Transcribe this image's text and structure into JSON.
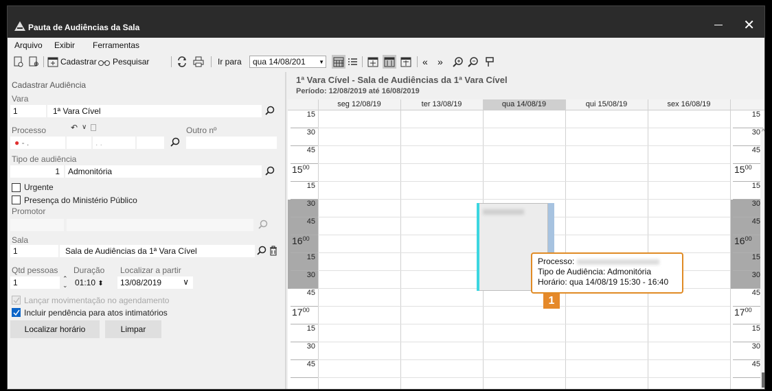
{
  "window": {
    "title": "Pauta de Audiências da Sala"
  },
  "menu": [
    "Arquivo",
    "Exibir",
    "Ferramentas"
  ],
  "toolbar": {
    "cadastrar": "Cadastrar",
    "pesquisar": "Pesquisar",
    "ir_para": "Ir para",
    "ir_para_value": "qua 14/08/201"
  },
  "form": {
    "section_title": "Cadastrar Audiência",
    "vara_label": "Vara",
    "vara_code": "1",
    "vara_name": "1ª Vara Cível",
    "processo_label": "Processo",
    "processo_value": "● - .",
    "outro_label": "Outro nº",
    "tipo_label": "Tipo de audiência",
    "tipo_code": "1",
    "tipo_name": "Admonitória",
    "urgente_label": "Urgente",
    "presenca_label": "Presença do Ministério Público",
    "promotor_label": "Promotor",
    "sala_label": "Sala",
    "sala_code": "1",
    "sala_name": "Sala de Audiências da 1ª Vara Cível",
    "qtd_label": "Qtd pessoas",
    "duracao_label": "Duração",
    "localizar_label": "Localizar a partir",
    "qtd_value": "1",
    "duracao_value": "01:10",
    "localizar_value": "13/08/2019",
    "lancar_label": "Lançar movimentação no agendamento",
    "incluir_label": "Incluir pendência para atos intimatórios",
    "btn_localizar": "Localizar horário",
    "btn_limpar": "Limpar"
  },
  "calendar": {
    "title": "1ª Vara Cível - Sala de Audiências da 1ª Vara Cível",
    "period": "Período: 12/08/2019 até 16/08/2019",
    "days": [
      "seg 12/08/19",
      "ter 13/08/19",
      "qua 14/08/19",
      "qui 15/08/19",
      "sex 16/08/19"
    ],
    "selected_day_index": 2,
    "slots": [
      {
        "label": "15",
        "hour": false,
        "shaded": false
      },
      {
        "label": "30",
        "hour": false,
        "shaded": false
      },
      {
        "label": "45",
        "hour": false,
        "shaded": false
      },
      {
        "label": "15",
        "sup": "00",
        "hour": true,
        "shaded": false
      },
      {
        "label": "15",
        "hour": false,
        "shaded": false
      },
      {
        "label": "30",
        "hour": false,
        "shaded": true
      },
      {
        "label": "45",
        "hour": false,
        "shaded": true
      },
      {
        "label": "16",
        "sup": "00",
        "hour": true,
        "shaded": true
      },
      {
        "label": "15",
        "hour": false,
        "shaded": true
      },
      {
        "label": "30",
        "hour": false,
        "shaded": true
      },
      {
        "label": "45",
        "hour": false,
        "shaded": false
      },
      {
        "label": "17",
        "sup": "00",
        "hour": true,
        "shaded": false
      },
      {
        "label": "15",
        "hour": false,
        "shaded": false
      },
      {
        "label": "30",
        "hour": false,
        "shaded": false
      },
      {
        "label": "45",
        "hour": false,
        "shaded": false
      }
    ]
  },
  "tooltip": {
    "processo": "Processo:",
    "tipo": "Tipo de Audiência: Admonitória",
    "horario": "Horário: qua 14/08/19 15:30 - 16:40"
  },
  "badge": "1",
  "colors": {
    "accent": "#e5892a",
    "event_bar": "#3cd6e0",
    "check": "#0a64c8"
  }
}
